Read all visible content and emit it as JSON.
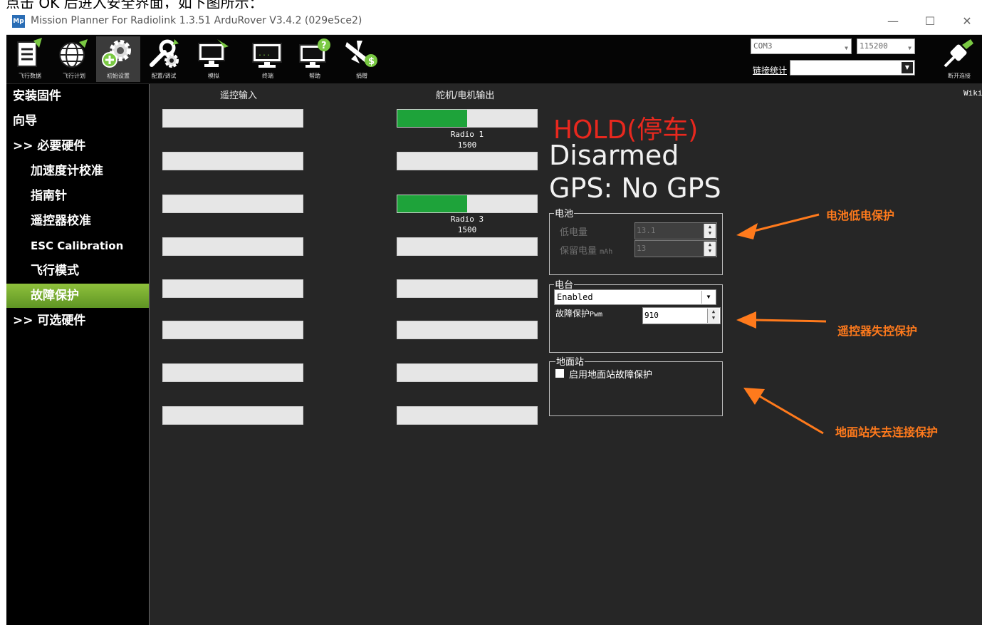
{
  "caption": "点击 OK 后进入安全界面，如下图所示：",
  "window": {
    "logo_text": "Mp",
    "title": "Mission Planner For Radiolink 1.3.51 ArduRover V3.4.2 (029e5ce2)",
    "minimize": "—",
    "maximize": "☐",
    "close": "✕"
  },
  "toolbar": {
    "items": [
      {
        "label": "飞行数据",
        "icon": "flight-data-icon"
      },
      {
        "label": "飞行计划",
        "icon": "flight-plan-icon"
      },
      {
        "label": "初始设置",
        "icon": "initial-setup-icon"
      },
      {
        "label": "配置/调试",
        "icon": "config-tuning-icon"
      },
      {
        "label": "模拟",
        "icon": "simulation-icon"
      },
      {
        "label": "终端",
        "icon": "terminal-icon"
      },
      {
        "label": "帮助",
        "icon": "help-icon"
      },
      {
        "label": "捐赠",
        "icon": "donate-icon"
      }
    ],
    "com_port": "COM3",
    "baud_rate": "115200",
    "link_stats": "链接统计",
    "disconnect_label": "断开连接",
    "wiki": "Wiki"
  },
  "sidebar": {
    "items": [
      {
        "label": "安装固件",
        "level": 0
      },
      {
        "label": "向导",
        "level": 0
      },
      {
        "label": ">> 必要硬件",
        "level": 0
      },
      {
        "label": "加速度计校准",
        "level": 1
      },
      {
        "label": "指南针",
        "level": 1
      },
      {
        "label": "遥控器校准",
        "level": 1
      },
      {
        "label": "ESC Calibration",
        "level": 1
      },
      {
        "label": "飞行模式",
        "level": 1
      },
      {
        "label": "故障保护",
        "level": 1,
        "active": true
      },
      {
        "label": ">> 可选硬件",
        "level": 0
      }
    ]
  },
  "main": {
    "rc_input_header": "遥控输入",
    "servo_output_header": "舵机/电机输出",
    "servo_outputs": [
      {
        "fill": 0.5,
        "label": "Radio 1",
        "value": "1500"
      },
      {
        "fill": 0,
        "label": "",
        "value": ""
      },
      {
        "fill": 0.5,
        "label": "Radio 3",
        "value": "1500"
      },
      {
        "fill": 0,
        "label": "",
        "value": ""
      },
      {
        "fill": 0,
        "label": "",
        "value": ""
      },
      {
        "fill": 0,
        "label": "",
        "value": ""
      },
      {
        "fill": 0,
        "label": "",
        "value": ""
      },
      {
        "fill": 0,
        "label": "",
        "value": ""
      }
    ],
    "mode": "HOLD(停车)",
    "arm_state": "Disarmed",
    "gps_state": "GPS: No GPS",
    "battery": {
      "title": "电池",
      "low_voltage_label": "低电量",
      "low_voltage_value": "13.1",
      "reserve_label": "保留电量",
      "reserve_unit": "mAh",
      "reserve_value": "13"
    },
    "radio": {
      "title": "电台",
      "mode_value": "Enabled",
      "pwm_label": "故障保护",
      "pwm_unit": "Pwm",
      "pwm_value": "910"
    },
    "gcs": {
      "title": "地面站",
      "checkbox_label": "启用地面站故障保护"
    }
  },
  "annotations": {
    "battery": "电池低电保护",
    "rc": "遥控器失控保护",
    "gcs": "地面站失去连接保护",
    "color": "#ff7a1c"
  }
}
